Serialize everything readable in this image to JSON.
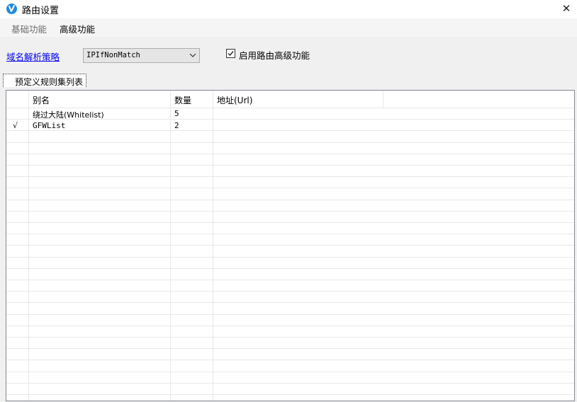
{
  "window": {
    "title": "路由设置",
    "close_glyph": "✕",
    "icon": "v-logo-icon"
  },
  "menu": {
    "items": [
      {
        "label": "基础功能",
        "active": false
      },
      {
        "label": "高级功能",
        "active": true
      }
    ]
  },
  "settings": {
    "dns_strategy_link": "域名解析策略",
    "dns_strategy_value": "IPIfNonMatch",
    "enable_advanced_checked": true,
    "enable_advanced_label": "启用路由高级功能"
  },
  "tab": {
    "label": "预定义规则集列表"
  },
  "grid": {
    "columns": [
      "",
      "别名",
      "数量",
      "地址(Url)"
    ],
    "rows": [
      {
        "mark": "",
        "alias": "绕过大陆(Whitelist)",
        "count": "5",
        "url": ""
      },
      {
        "mark": "√",
        "alias": "GFWList",
        "count": "2",
        "url": ""
      }
    ]
  },
  "colors": {
    "accent": "#1f8ae0",
    "link": "#0000ee",
    "panel_bg": "#f0f0f0",
    "grid_line": "#e8e8e8"
  }
}
